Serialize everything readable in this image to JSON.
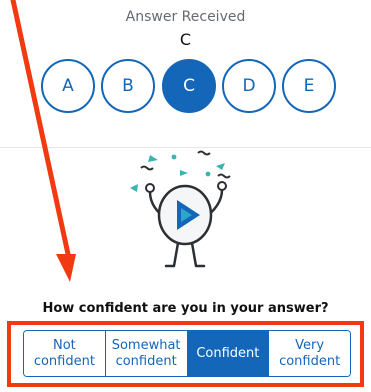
{
  "answer": {
    "label": "Answer Received",
    "value": "C",
    "choices": [
      {
        "label": "A",
        "selected": false
      },
      {
        "label": "B",
        "selected": false
      },
      {
        "label": "C",
        "selected": true
      },
      {
        "label": "D",
        "selected": false
      },
      {
        "label": "E",
        "selected": false
      }
    ]
  },
  "confidence": {
    "question": "How confident are you in your answer?",
    "options": [
      {
        "label": "Not\nconfident",
        "selected": false
      },
      {
        "label": "Somewhat\nconfident",
        "selected": false
      },
      {
        "label": "Confident",
        "selected": true
      },
      {
        "label": "Very\nconfident",
        "selected": false
      }
    ]
  },
  "icons": {
    "mascot": "celebrating-play-mascot-icon",
    "annotation_arrow": "red-arrow-icon"
  },
  "colors": {
    "accent": "#1466b8",
    "annotation": "#f23a12",
    "confetti": "#3bb4b0"
  }
}
